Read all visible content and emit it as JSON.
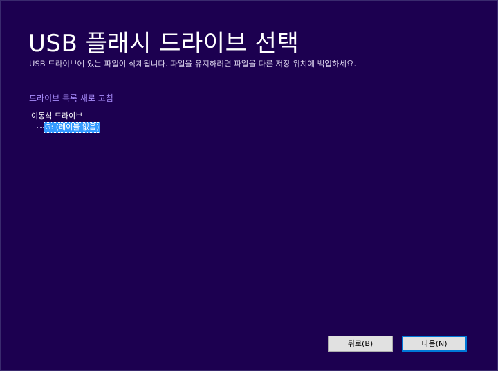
{
  "header": {
    "title": "USB 플래시 드라이브 선택",
    "subtitle": "USB 드라이브에 있는 파일이 삭제됩니다. 파일을 유지하려면 파일을 다른 저장 위치에 백업하세요."
  },
  "refresh_link": "드라이브 목록 새로 고침",
  "tree": {
    "root_label": "이동식 드라이브",
    "items": [
      {
        "label": "G: (레이블 없음)",
        "selected": true
      }
    ]
  },
  "buttons": {
    "back_label": "뒤로",
    "back_accel": "B",
    "next_label": "다음",
    "next_accel": "N"
  },
  "colors": {
    "background": "#1c0050",
    "link": "#a78bfa",
    "selection": "#3399ff",
    "default_button_border": "#0078d7"
  }
}
